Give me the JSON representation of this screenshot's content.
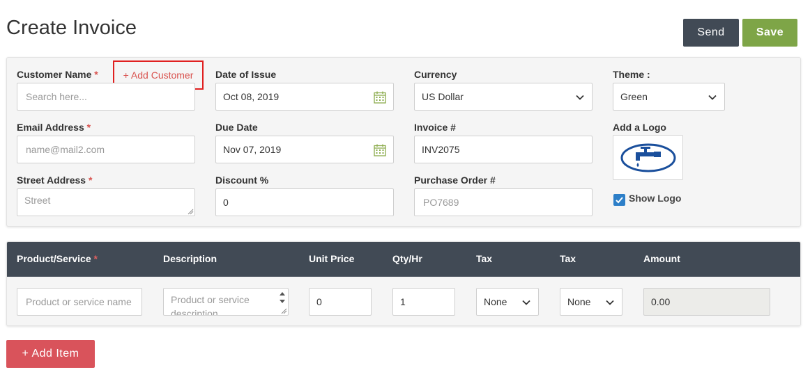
{
  "page": {
    "title": "Create Invoice"
  },
  "header": {
    "send_label": "Send",
    "save_label": "Save"
  },
  "form": {
    "customer_name": {
      "label": "Customer Name",
      "required": "*",
      "placeholder": "Search here...",
      "add_link": "+ Add Customer"
    },
    "email": {
      "label": "Email Address",
      "required": "*",
      "placeholder": "name@mail2.com"
    },
    "street": {
      "label": "Street Address",
      "required": "*",
      "placeholder": "Street"
    },
    "date_of_issue": {
      "label": "Date of Issue",
      "value": "Oct 08, 2019"
    },
    "due_date": {
      "label": "Due Date",
      "value": "Nov 07, 2019"
    },
    "discount": {
      "label": "Discount %",
      "value": "0"
    },
    "currency": {
      "label": "Currency",
      "value": "US Dollar"
    },
    "invoice_no": {
      "label": "Invoice #",
      "value": "INV2075"
    },
    "purchase_order": {
      "label": "Purchase Order #",
      "placeholder": "PO7689"
    },
    "theme": {
      "label": "Theme :",
      "value": "Green"
    },
    "logo": {
      "label": "Add a Logo",
      "icon": "faucet-logo-icon"
    },
    "show_logo": {
      "label": "Show Logo",
      "checked": true
    }
  },
  "items_table": {
    "columns": [
      {
        "label": "Product/Service",
        "required": "*"
      },
      {
        "label": "Description"
      },
      {
        "label": "Unit Price"
      },
      {
        "label": "Qty/Hr"
      },
      {
        "label": "Tax"
      },
      {
        "label": "Tax"
      },
      {
        "label": "Amount"
      }
    ],
    "row": {
      "product_placeholder": "Product or service name",
      "description_placeholder": "Product or service description...",
      "unit_price": "0",
      "qty": "1",
      "tax1": "None",
      "tax2": "None",
      "amount": "0.00"
    }
  },
  "add_item_label": "+ Add Item",
  "colors": {
    "send": "#414a55",
    "save": "#7ea547",
    "add_item": "#d9535b",
    "required": "#d9534f",
    "header": "#414a55",
    "checkbox": "#2d7fc8",
    "logo_blue": "#1a4f9c"
  }
}
